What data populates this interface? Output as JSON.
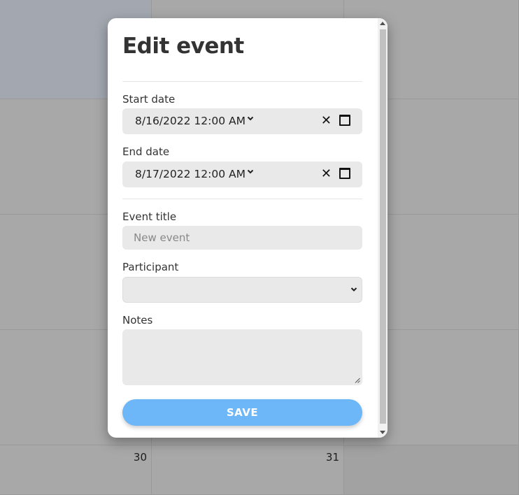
{
  "calendar": {
    "day_numbers": [
      "30",
      "31"
    ]
  },
  "modal": {
    "title": "Edit event",
    "start_date": {
      "label": "Start date",
      "value": "8/16/2022 12:00  AM"
    },
    "end_date": {
      "label": "End date",
      "value": "8/17/2022 12:00  AM"
    },
    "event_title": {
      "label": "Event title",
      "placeholder": "New event",
      "value": ""
    },
    "participant": {
      "label": "Participant",
      "selected": ""
    },
    "notes": {
      "label": "Notes",
      "value": ""
    },
    "save_label": "SAVE"
  },
  "colors": {
    "save_button": "#6db6f7",
    "field_background": "#e9e9e9",
    "overlay": "#a6a6a6"
  },
  "icons": {
    "clear": "close-icon",
    "calendar": "calendar-icon",
    "dropdown": "chevron-down-icon"
  }
}
